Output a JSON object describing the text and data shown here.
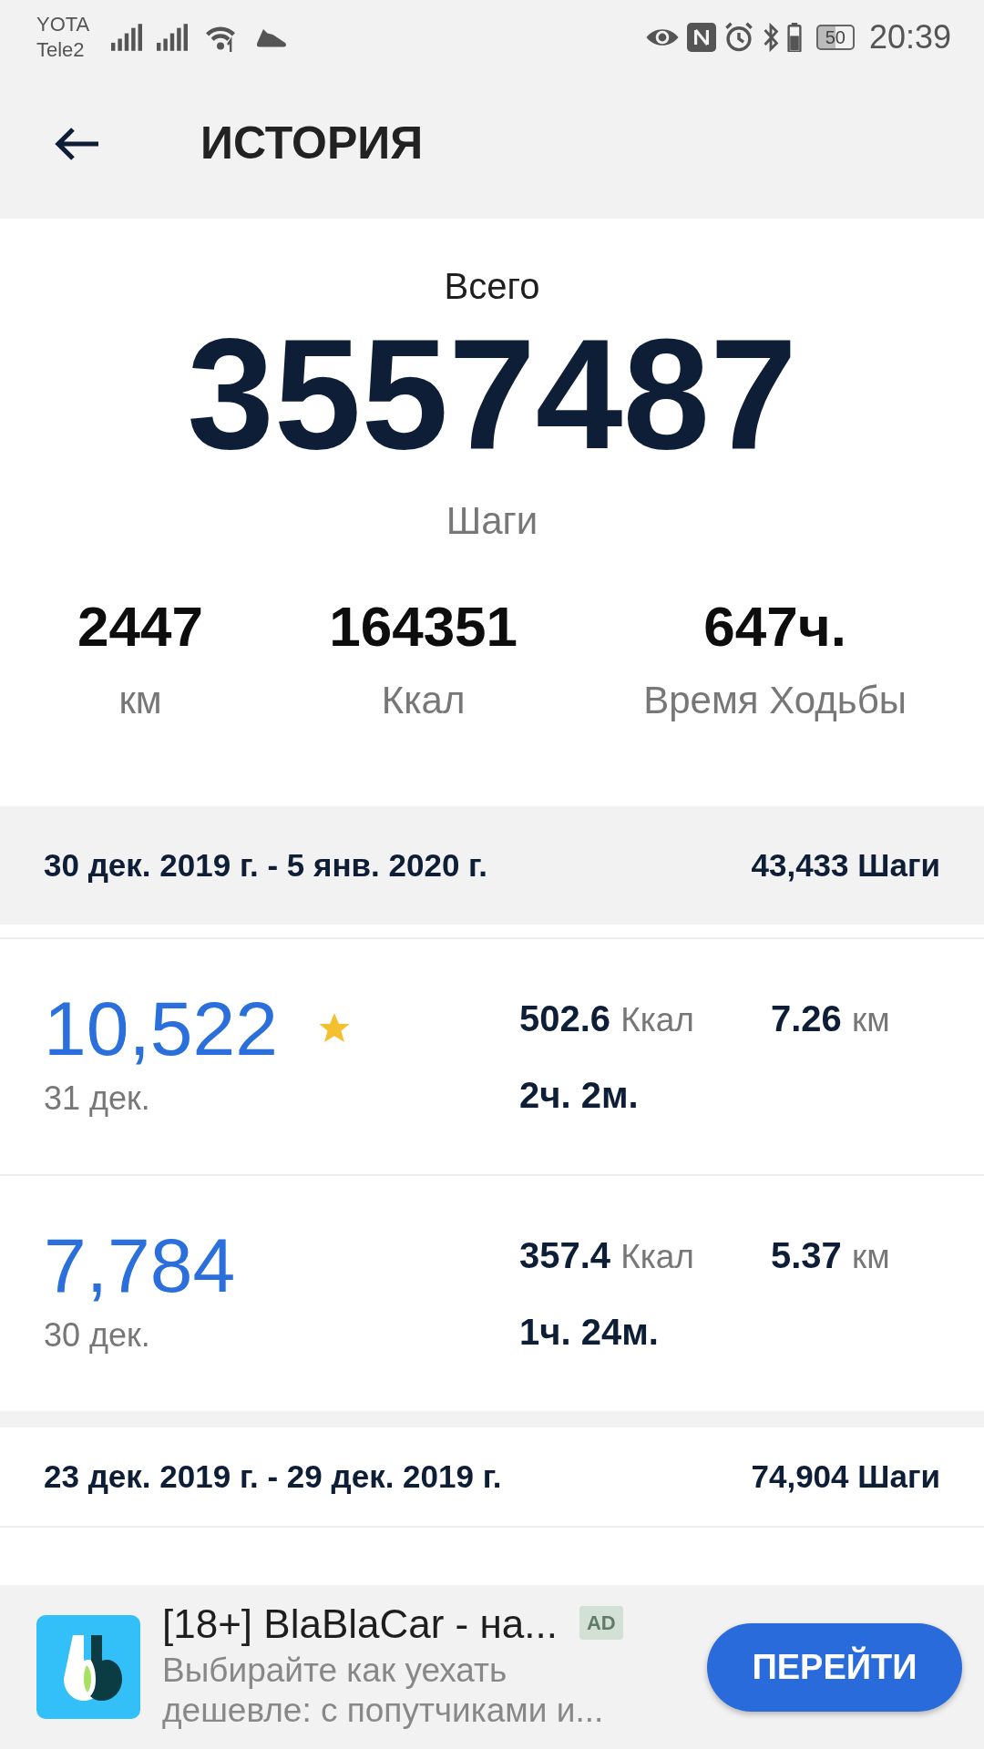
{
  "status_bar": {
    "carriers": [
      "YOTA",
      "Tele2"
    ],
    "battery": "50",
    "time": "20:39"
  },
  "app_bar": {
    "title": "ИСТОРИЯ"
  },
  "summary": {
    "label": "Всего",
    "total": "3557487",
    "unit": "Шаги",
    "stats": [
      {
        "value": "2447",
        "label": "км"
      },
      {
        "value": "164351",
        "label": "Ккал"
      },
      {
        "value": "647ч.",
        "label": "Время Ходьбы"
      }
    ]
  },
  "weeks": [
    {
      "range": "30 дек. 2019 г. - 5 янв. 2020 г.",
      "total": "43,433 Шаги",
      "days": [
        {
          "steps": "10,522",
          "date": "31 дек.",
          "goal_reached": true,
          "kcal": "502.6",
          "kcal_unit": "Ккал",
          "km": "7.26",
          "km_unit": "км",
          "duration": "2ч. 2м."
        },
        {
          "steps": "7,784",
          "date": "30 дек.",
          "goal_reached": false,
          "kcal": "357.4",
          "kcal_unit": "Ккал",
          "km": "5.37",
          "km_unit": "км",
          "duration": "1ч. 24м."
        }
      ]
    },
    {
      "range": "23 дек. 2019 г. - 29 дек. 2019 г.",
      "total": "74,904 Шаги"
    }
  ],
  "ad": {
    "title": "[18+] BlaBlaCar - на...",
    "badge": "AD",
    "description": "Выбирайте как уехать дешевле: с попутчиками и...",
    "button": "ПЕРЕЙТИ"
  }
}
